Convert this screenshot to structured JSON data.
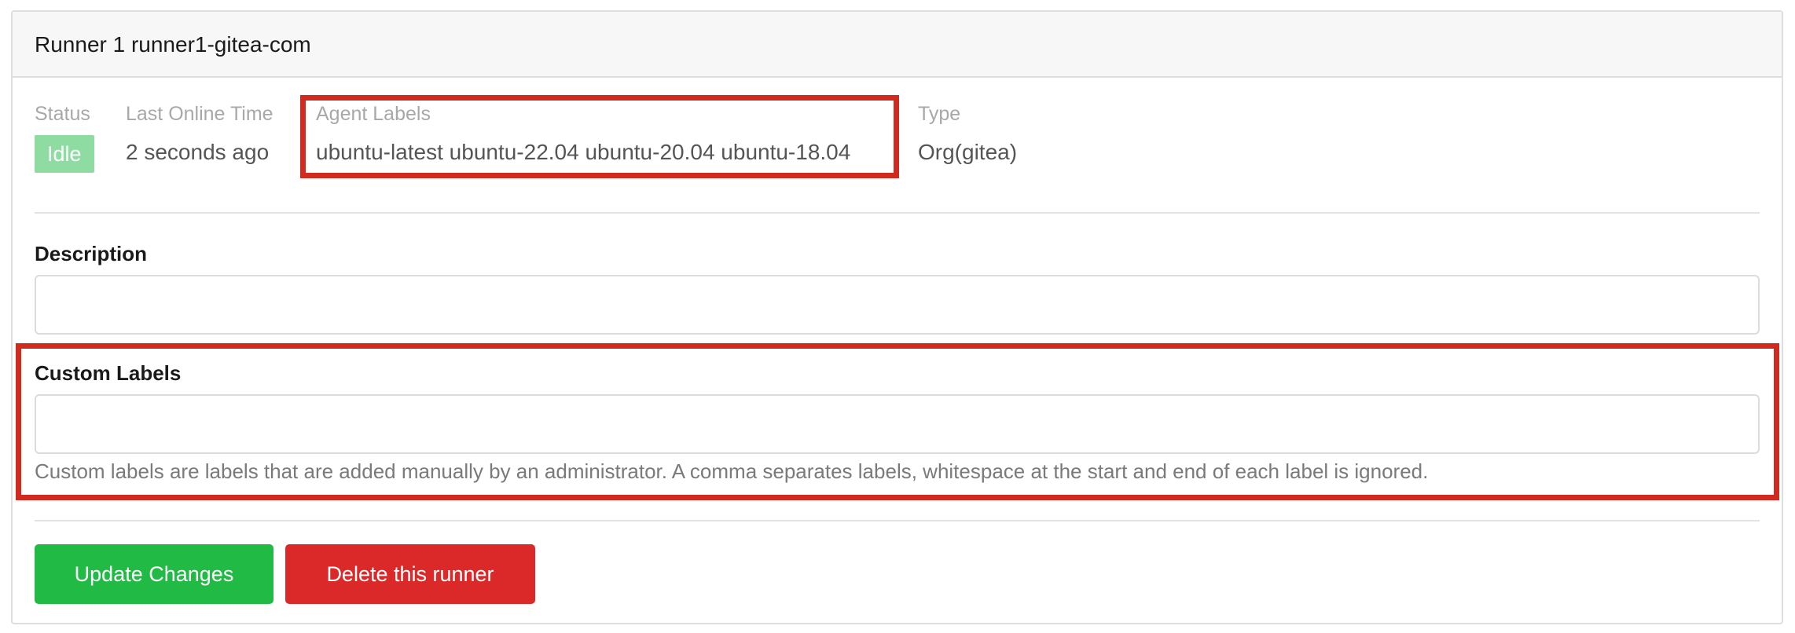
{
  "runner": {
    "title": "Runner 1 runner1-gitea-com"
  },
  "info": {
    "status_label": "Status",
    "status_value": "Idle",
    "last_online_label": "Last Online Time",
    "last_online_value": "2 seconds ago",
    "agent_labels_label": "Agent Labels",
    "agent_labels_value": "ubuntu-latest ubuntu-22.04 ubuntu-20.04 ubuntu-18.04",
    "type_label": "Type",
    "type_value": "Org(gitea)"
  },
  "form": {
    "description_label": "Description",
    "description_value": "",
    "custom_labels_label": "Custom Labels",
    "custom_labels_value": "",
    "custom_labels_help": "Custom labels are labels that are added manually by an administrator. A comma separates labels, whitespace at the start and end of each label is ignored."
  },
  "actions": {
    "update_label": "Update Changes",
    "delete_label": "Delete this runner"
  },
  "colors": {
    "status_idle": "#8fdca3",
    "update_button": "#21ba45",
    "delete_button": "#db2828",
    "highlight": "#d12b1f"
  }
}
